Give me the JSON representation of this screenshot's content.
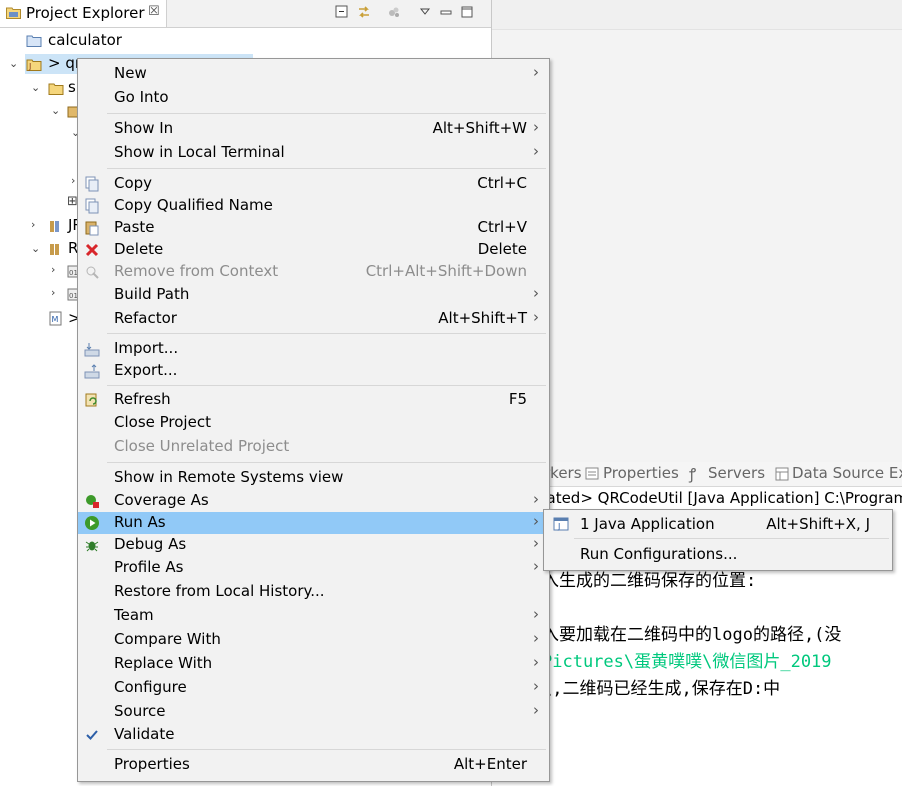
{
  "explorer": {
    "tab_title": "Project Explorer",
    "close_glyph": "☒",
    "tree": [
      {
        "label": "calculator",
        "icon": "project-folder-icon",
        "expanded": false
      },
      {
        "label": "> qr",
        "icon": "java-project-icon",
        "expanded": true,
        "selected": true
      },
      {
        "label": "s",
        "icon": "source-folder-icon",
        "expanded": true
      },
      {
        "label": "",
        "icon": "package-icon",
        "expanded": true
      },
      {
        "label": "JR",
        "icon": "library-icon",
        "expanded": false
      },
      {
        "label": "R",
        "icon": "referenced-libraries-icon",
        "expanded": true
      },
      {
        "label": ">",
        "icon": "pom-file-icon",
        "expanded": false
      }
    ]
  },
  "bottom_panel": {
    "tabs": [
      "rkers",
      "Properties",
      "Servers",
      "Data Source Exp"
    ],
    "console_header": "nated> QRCodeUtil [Java Application] C:\\Program",
    "console_lines": [
      {
        "text": "入生成的二维码保存的位置:",
        "color": "#000000"
      },
      {
        "text": "入要加载在二维码中的logo的路径,(没",
        "color": "#000000"
      },
      {
        "text": "Pictures\\蛋黄噗噗\\微信图片_2019",
        "color": "#00c87d"
      },
      {
        "text": "\\,二维码已经生成,保存在D:中",
        "color": "#000000"
      }
    ]
  },
  "context_menu": {
    "items": [
      {
        "label": "New",
        "accel": "",
        "submenu": true,
        "enabled": true,
        "icon": ""
      },
      {
        "label": "Go Into",
        "accel": "",
        "submenu": false,
        "enabled": true,
        "icon": ""
      },
      {
        "label": "Show In",
        "accel": "Alt+Shift+W",
        "submenu": true,
        "enabled": true,
        "icon": ""
      },
      {
        "label": "Show in Local Terminal",
        "accel": "",
        "submenu": true,
        "enabled": true,
        "icon": ""
      },
      {
        "label": "Copy",
        "accel": "Ctrl+C",
        "submenu": false,
        "enabled": true,
        "icon": "copy-icon"
      },
      {
        "label": "Copy Qualified Name",
        "accel": "",
        "submenu": false,
        "enabled": true,
        "icon": "copy-qualified-name-icon"
      },
      {
        "label": "Paste",
        "accel": "Ctrl+V",
        "submenu": false,
        "enabled": true,
        "icon": "paste-icon"
      },
      {
        "label": "Delete",
        "accel": "Delete",
        "submenu": false,
        "enabled": true,
        "icon": "delete-icon"
      },
      {
        "label": "Remove from Context",
        "accel": "Ctrl+Alt+Shift+Down",
        "submenu": false,
        "enabled": false,
        "icon": "remove-from-context-icon"
      },
      {
        "label": "Build Path",
        "accel": "",
        "submenu": true,
        "enabled": true,
        "icon": ""
      },
      {
        "label": "Refactor",
        "accel": "Alt+Shift+T",
        "submenu": true,
        "enabled": true,
        "icon": ""
      },
      {
        "label": "Import...",
        "accel": "",
        "submenu": false,
        "enabled": true,
        "icon": "import-icon"
      },
      {
        "label": "Export...",
        "accel": "",
        "submenu": false,
        "enabled": true,
        "icon": "export-icon"
      },
      {
        "label": "Refresh",
        "accel": "F5",
        "submenu": false,
        "enabled": true,
        "icon": "refresh-icon"
      },
      {
        "label": "Close Project",
        "accel": "",
        "submenu": false,
        "enabled": true,
        "icon": ""
      },
      {
        "label": "Close Unrelated Project",
        "accel": "",
        "submenu": false,
        "enabled": false,
        "icon": ""
      },
      {
        "label": "Show in Remote Systems view",
        "accel": "",
        "submenu": false,
        "enabled": true,
        "icon": ""
      },
      {
        "label": "Coverage As",
        "accel": "",
        "submenu": true,
        "enabled": true,
        "icon": "coverage-icon"
      },
      {
        "label": "Run As",
        "accel": "",
        "submenu": true,
        "enabled": true,
        "icon": "run-icon",
        "highlighted": true
      },
      {
        "label": "Debug As",
        "accel": "",
        "submenu": true,
        "enabled": true,
        "icon": "debug-icon"
      },
      {
        "label": "Profile As",
        "accel": "",
        "submenu": true,
        "enabled": true,
        "icon": ""
      },
      {
        "label": "Restore from Local History...",
        "accel": "",
        "submenu": false,
        "enabled": true,
        "icon": ""
      },
      {
        "label": "Team",
        "accel": "",
        "submenu": true,
        "enabled": true,
        "icon": ""
      },
      {
        "label": "Compare With",
        "accel": "",
        "submenu": true,
        "enabled": true,
        "icon": ""
      },
      {
        "label": "Replace With",
        "accel": "",
        "submenu": true,
        "enabled": true,
        "icon": ""
      },
      {
        "label": "Configure",
        "accel": "",
        "submenu": true,
        "enabled": true,
        "icon": ""
      },
      {
        "label": "Source",
        "accel": "",
        "submenu": true,
        "enabled": true,
        "icon": ""
      },
      {
        "label": "Validate",
        "accel": "",
        "submenu": false,
        "enabled": true,
        "icon": "validate-check-icon"
      },
      {
        "label": "Properties",
        "accel": "Alt+Enter",
        "submenu": false,
        "enabled": true,
        "icon": ""
      }
    ],
    "submenu_arrow": "›"
  },
  "run_as_submenu": {
    "items": [
      {
        "label": "1 Java Application",
        "accel": "Alt+Shift+X, J",
        "icon": "java-application-icon"
      },
      {
        "label": "Run Configurations...",
        "accel": "",
        "icon": ""
      }
    ]
  },
  "colors": {
    "menu_bg": "#f2f2f2",
    "highlight": "#91c9f7",
    "selection": "#cce4f7",
    "disabled_text": "#8d8d8d",
    "console_link": "#00c87d"
  }
}
